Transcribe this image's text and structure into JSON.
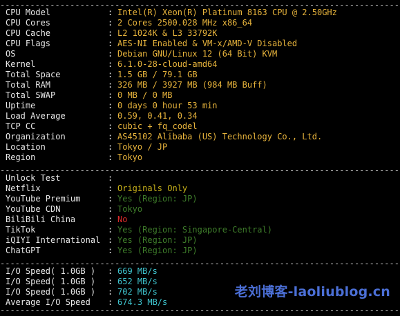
{
  "rule_text": "----------------------------------------------------------------------------------------------",
  "colors": {
    "default": "#e8e8e8",
    "info": "#e8b43c",
    "cyan": "#3fc6d0",
    "yes": "#3e7d2a",
    "no": "#e02b2b",
    "originals": "#c9b21a",
    "watermark": "#4b6fd6"
  },
  "system": [
    {
      "label": "CPU Model",
      "value": "Intel(R) Xeon(R) Platinum 8163 CPU @ 2.50GHz",
      "tone": "info"
    },
    {
      "label": "CPU Cores",
      "value": "2 Cores 2500.028 MHz x86_64",
      "tone": "info"
    },
    {
      "label": "CPU Cache",
      "value": "L2 1024K & L3 33792K",
      "tone": "info"
    },
    {
      "label": "CPU Flags",
      "value": "AES-NI Enabled & VM-x/AMD-V Disabled",
      "tone": "info"
    },
    {
      "label": "OS",
      "value": "Debian GNU/Linux 12 (64 Bit) KVM",
      "tone": "info"
    },
    {
      "label": "Kernel",
      "value": "6.1.0-28-cloud-amd64",
      "tone": "info"
    },
    {
      "label": "Total Space",
      "value": "1.5 GB / 79.1 GB",
      "tone": "info"
    },
    {
      "label": "Total RAM",
      "value": "326 MB / 3927 MB (984 MB Buff)",
      "tone": "info"
    },
    {
      "label": "Total SWAP",
      "value": "0 MB / 0 MB",
      "tone": "info"
    },
    {
      "label": "Uptime",
      "value": "0 days 0 hour 53 min",
      "tone": "info"
    },
    {
      "label": "Load Average",
      "value": "0.59, 0.41, 0.34",
      "tone": "info"
    },
    {
      "label": "TCP CC",
      "value": "cubic + fq_codel",
      "tone": "info"
    },
    {
      "label": "Organization",
      "value": "AS45102 Alibaba (US) Technology Co., Ltd.",
      "tone": "info"
    },
    {
      "label": "Location",
      "value": "Tokyo / JP",
      "tone": "info"
    },
    {
      "label": "Region",
      "value": "Tokyo",
      "tone": "info"
    }
  ],
  "unlock": [
    {
      "label": "Unlock Test",
      "value": "",
      "tone": "default"
    },
    {
      "label": "Netflix",
      "value": "Originals Only",
      "tone": "originals"
    },
    {
      "label": "YouTube Premium",
      "value": "Yes (Region: JP)",
      "tone": "yes"
    },
    {
      "label": "YouTube CDN",
      "value": "Tokyo",
      "tone": "yes"
    },
    {
      "label": "BiliBili China",
      "value": "No",
      "tone": "no"
    },
    {
      "label": "TikTok",
      "value": "Yes (Region: Singapore-Central)",
      "tone": "yes"
    },
    {
      "label": "iQIYI International",
      "value": "Yes (Region: JP)",
      "tone": "yes"
    },
    {
      "label": "ChatGPT",
      "value": "Yes (Region: JP)",
      "tone": "yes"
    }
  ],
  "io": [
    {
      "label": "I/O Speed( 1.0GB )",
      "value": "669 MB/s",
      "tone": "cyan"
    },
    {
      "label": "I/O Speed( 1.0GB )",
      "value": "652 MB/s",
      "tone": "cyan"
    },
    {
      "label": "I/O Speed( 1.0GB )",
      "value": "702 MB/s",
      "tone": "cyan"
    },
    {
      "label": "Average I/O Speed",
      "value": "674.3 MB/s",
      "tone": "cyan"
    }
  ],
  "separator": ":",
  "watermark": "老刘博客-laoliublog.cn"
}
